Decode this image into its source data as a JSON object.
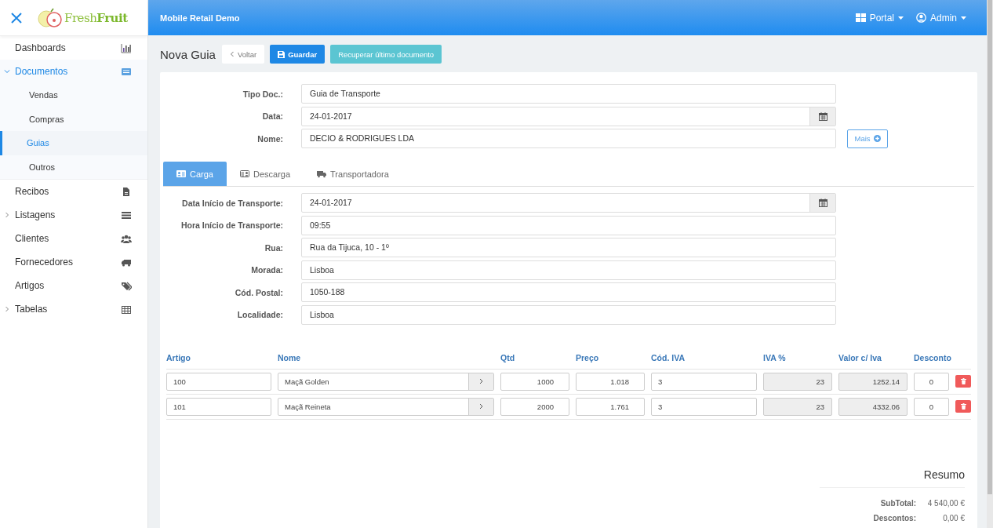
{
  "sidebar": {
    "logo": "Fresh**Fruit**",
    "items": [
      {
        "label": "Dashboards",
        "selected": false
      },
      {
        "label": "Documentos",
        "selected": false,
        "expanded": true,
        "children": [
          {
            "label": "Vendas",
            "selected": false
          },
          {
            "label": "Compras",
            "selected": false
          },
          {
            "label": "Guias",
            "selected": true
          },
          {
            "label": "Outros",
            "selected": false
          }
        ]
      },
      {
        "label": "Recibos",
        "selected": false
      },
      {
        "label": "Listagens",
        "selected": false,
        "expanded": false
      },
      {
        "label": "Clientes",
        "selected": false
      },
      {
        "label": "Fornecedores",
        "selected": false
      },
      {
        "label": "Artigos",
        "selected": false
      },
      {
        "label": "Tabelas",
        "selected": false,
        "expanded": false
      }
    ]
  },
  "topbar": {
    "title": "Mobile Retail Demo",
    "menus": [
      {
        "label": "Portal"
      },
      {
        "label": "Admin"
      }
    ]
  },
  "page": {
    "title": "Nova Guia",
    "buttons": [
      {
        "label": "Voltar",
        "kind": "back"
      },
      {
        "label": "Guardar",
        "kind": "primary"
      },
      {
        "label": "Recuperar último documento",
        "kind": "info"
      }
    ]
  },
  "header_fields": [
    {
      "label": "Tipo Doc.:",
      "value": "Guia de Transporte",
      "kind": "text"
    },
    {
      "label": "Data:",
      "value": "24-01-2017",
      "kind": "date"
    },
    {
      "label": "Nome:",
      "value": "DECIO & RODRIGUES LDA",
      "kind": "text",
      "action": "Mais"
    }
  ],
  "tabs": [
    {
      "label": "Carga",
      "selected": true
    },
    {
      "label": "Descarga",
      "selected": false
    },
    {
      "label": "Transportadora",
      "selected": false
    }
  ],
  "transport_fields": [
    {
      "label": "Data Início de Transporte:",
      "value": "24-01-2017",
      "kind": "date"
    },
    {
      "label": "Hora Início de Transporte:",
      "value": "09:55",
      "kind": "text"
    },
    {
      "label": "Rua:",
      "value": "Rua da Tijuca, 10 - 1º",
      "kind": "text"
    },
    {
      "label": "Morada:",
      "value": "Lisboa",
      "kind": "text"
    },
    {
      "label": "Cód. Postal:",
      "value": "1050-188",
      "kind": "text"
    },
    {
      "label": "Localidade:",
      "value": "Lisboa",
      "kind": "text"
    }
  ],
  "lines": {
    "columns": [
      "Artigo",
      "Nome",
      "Qtd",
      "Preço",
      "Cód. IVA",
      "IVA %",
      "Valor c/ Iva",
      "Desconto"
    ],
    "rows": [
      {
        "artigo": "100",
        "nome": "Maçã Golden",
        "qtd": "1000",
        "preco": "1.018",
        "cod_iva": "3",
        "iva_pct": "23",
        "valor": "1252.14",
        "desconto": "0"
      },
      {
        "artigo": "101",
        "nome": "Maçã Reineta",
        "qtd": "2000",
        "preco": "1.761",
        "cod_iva": "3",
        "iva_pct": "23",
        "valor": "4332.06",
        "desconto": "0"
      }
    ]
  },
  "summary": {
    "title": "Resumo",
    "rows": [
      {
        "label": "SubTotal:",
        "value": "4 540,00 €"
      },
      {
        "label": "Descontos:",
        "value": "0,00 €"
      }
    ]
  }
}
